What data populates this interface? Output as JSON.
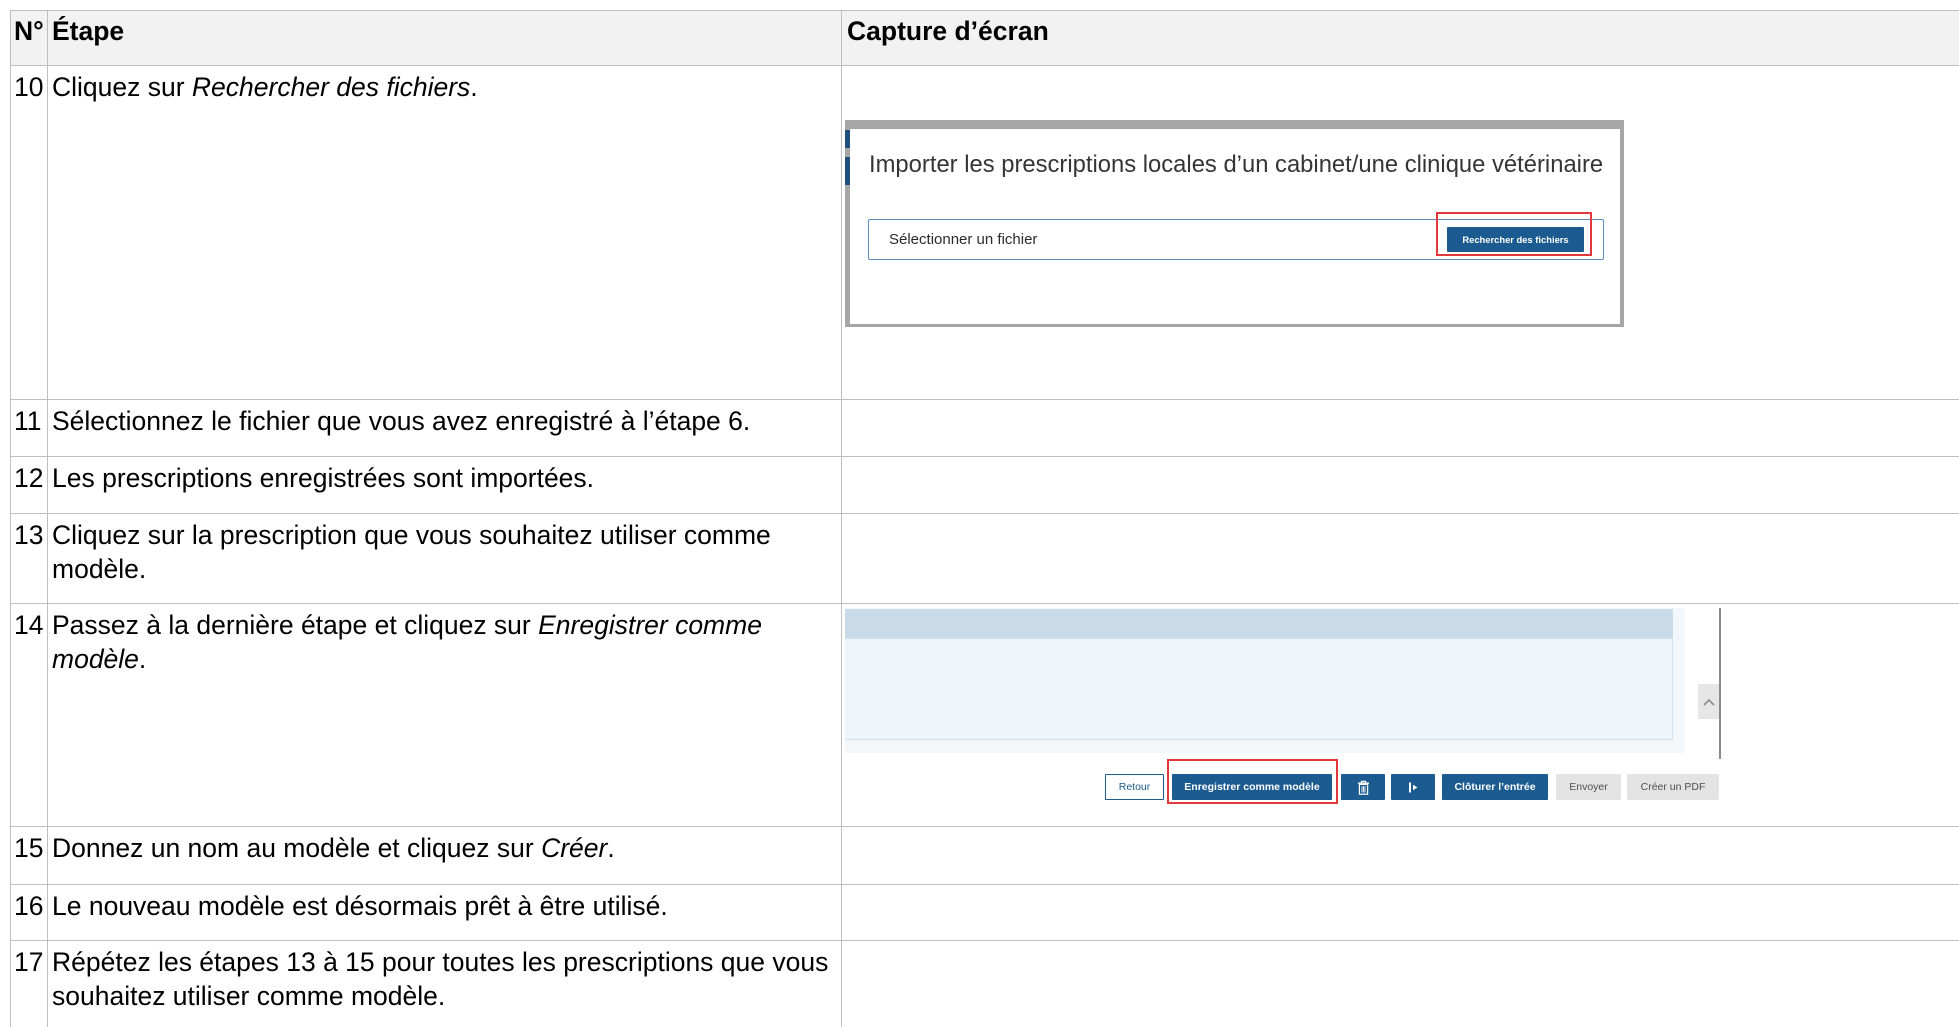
{
  "document": {
    "header": {
      "number": "N°",
      "step": "Étape",
      "screenshot": "Capture d’écran"
    },
    "steps": [
      {
        "number": "10",
        "text": "Cliquez sur ",
        "emphasis": "Rechercher des fichiers",
        "text_end": "."
      },
      {
        "number": "11",
        "text": "Sélectionnez le fichier que vous avez enregistré à l’étape 6."
      },
      {
        "number": "12",
        "text": "Les prescriptions enregistrées sont importées."
      },
      {
        "number": "13",
        "text": "Cliquez sur la prescription que vous souhaitez utiliser comme modèle."
      },
      {
        "number": "14",
        "text": "Passez à la dernière étape et cliquez sur ",
        "emphasis": "Enregistrer comme modèle",
        "text_end": "."
      },
      {
        "number": "15",
        "text": "Donnez un nom au modèle et cliquez sur ",
        "emphasis": "Créer",
        "text_end": "."
      },
      {
        "number": "16",
        "text": "Le nouveau modèle est désormais prêt à être utilisé."
      },
      {
        "number": "17",
        "text": "Répétez les étapes 13 à 15 pour toutes les prescriptions que vous souhaitez utiliser comme modèle."
      }
    ]
  },
  "import_dialog": {
    "title": "Importer les prescriptions locales d’un cabinet/une clinique vétérinaire",
    "file_field_label": "Sélectionner un fichier",
    "browse_button": "Rechercher des fichiers"
  },
  "action_bar": {
    "back": "Retour",
    "save_as_template": "Enregistrer comme modèle",
    "delete_icon": "trash-icon",
    "export_icon": "export-icon",
    "close_entry": "Clôturer l’entrée",
    "send": "Envoyer",
    "create_pdf": "Créer un PDF",
    "scroll_icon": "chevron-up-icon"
  },
  "colors": {
    "table_header_bg": "#f2f2f2",
    "table_border": "#bfbfbf",
    "primary_button": "#1c5b90",
    "highlight_frame": "#e2383c",
    "muted_button": "#e3e3e3",
    "panel_header": "#c9dbe9"
  }
}
